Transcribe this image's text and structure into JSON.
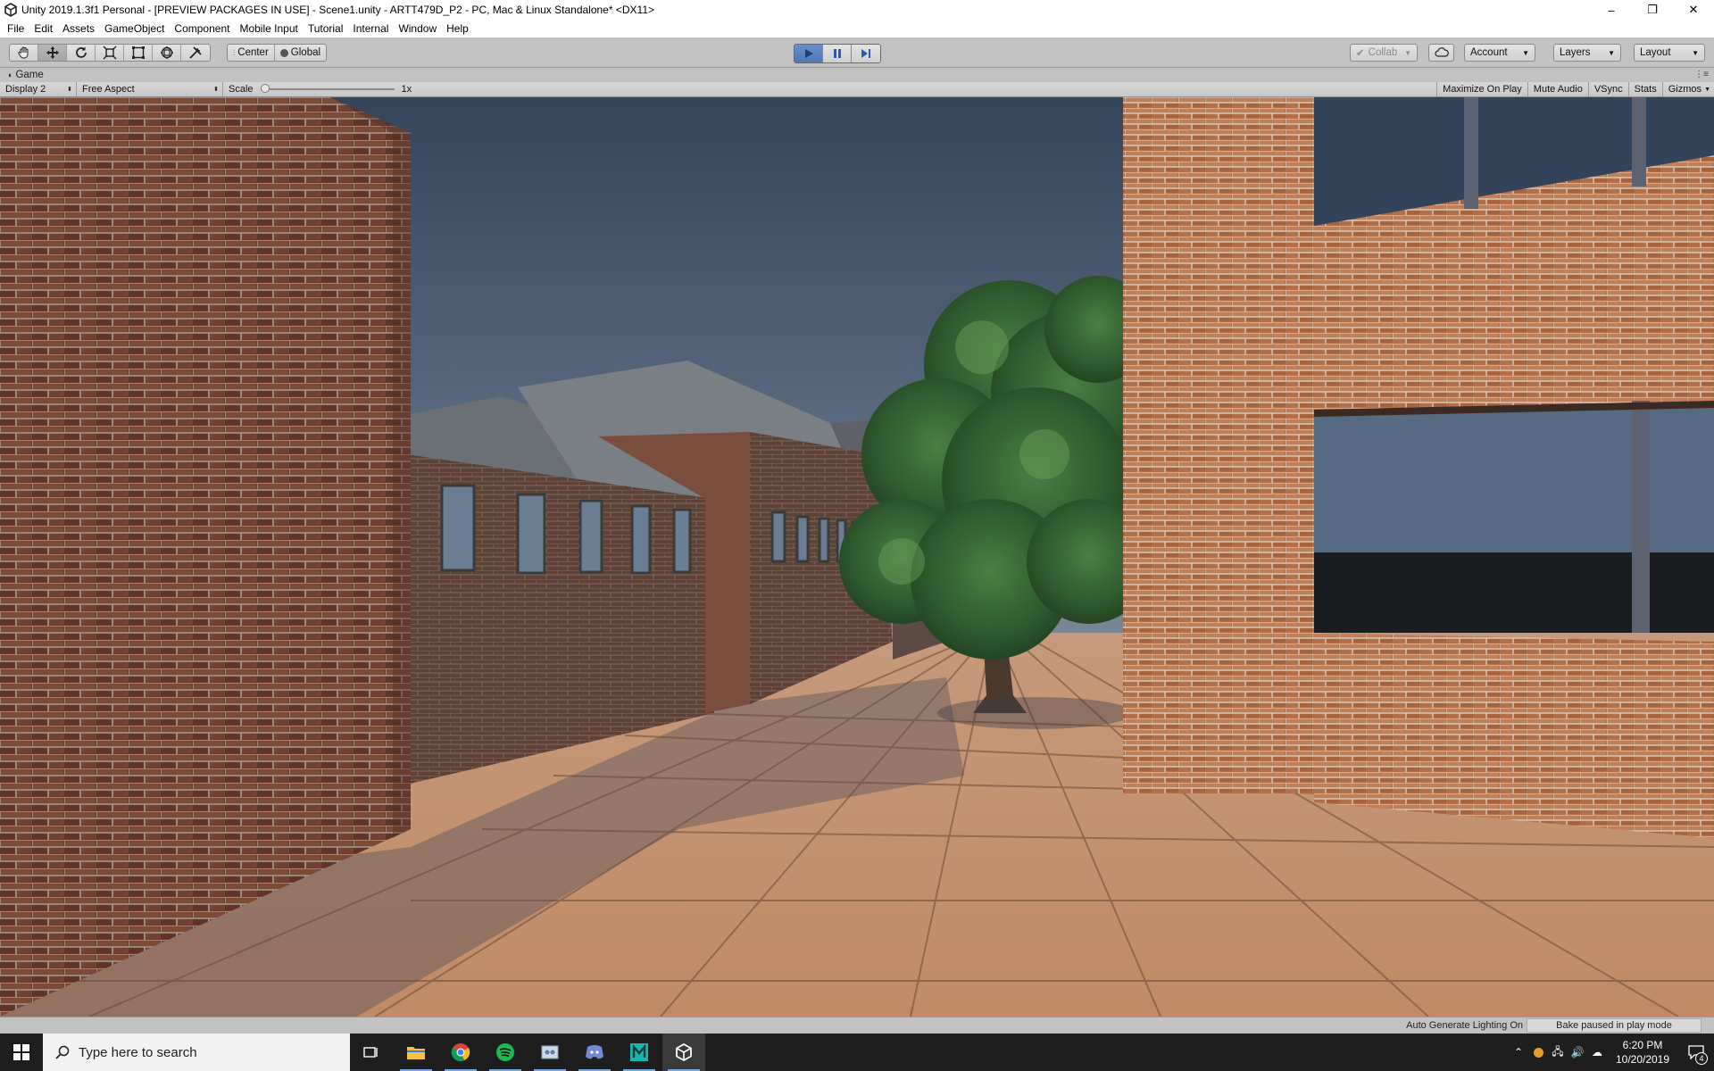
{
  "window": {
    "title": "Unity 2019.1.3f1 Personal - [PREVIEW PACKAGES IN USE] - Scene1.unity - ARTT479D_P2 - PC, Mac & Linux Standalone* <DX11>",
    "minimize": "–",
    "maximize": "❐",
    "close": "✕"
  },
  "menu": [
    "File",
    "Edit",
    "Assets",
    "GameObject",
    "Component",
    "Mobile Input",
    "Tutorial",
    "Internal",
    "Window",
    "Help"
  ],
  "toolbar": {
    "tools": [
      "hand-tool",
      "move-tool",
      "rotate-tool",
      "scale-tool",
      "rect-tool",
      "transform-tool",
      "custom-tool"
    ],
    "active_tool": "move-tool",
    "pivot_label": "Center",
    "space_label": "Global",
    "play_state": "playing",
    "collab_label": "Collab",
    "account_label": "Account",
    "layers_label": "Layers",
    "layout_label": "Layout"
  },
  "game_view": {
    "tab_label": "Game",
    "display_label": "Display 2",
    "aspect_label": "Free Aspect",
    "scale_label": "Scale",
    "scale_value": "1x",
    "scale_level": 0.0,
    "maximize_label": "Maximize On Play",
    "mute_label": "Mute Audio",
    "vsync_label": "VSync",
    "stats_label": "Stats",
    "gizmos_label": "Gizmos"
  },
  "status": {
    "lighting": "Auto Generate Lighting On",
    "bake": "Bake paused in play mode"
  },
  "taskbar": {
    "search_placeholder": "Type here to search",
    "apps": [
      "task-view",
      "file-explorer",
      "chrome",
      "spotify",
      "snipping",
      "discord",
      "maya",
      "unity"
    ],
    "time": "6:20 PM",
    "date": "10/20/2019",
    "notification_count": "4"
  },
  "colors": {
    "editor_bg": "#c2c2c2",
    "play_active": "#4f76b6",
    "sky_top": "#39485c",
    "brick": "#a06a4a",
    "taskbar": "#1e1e1e"
  }
}
